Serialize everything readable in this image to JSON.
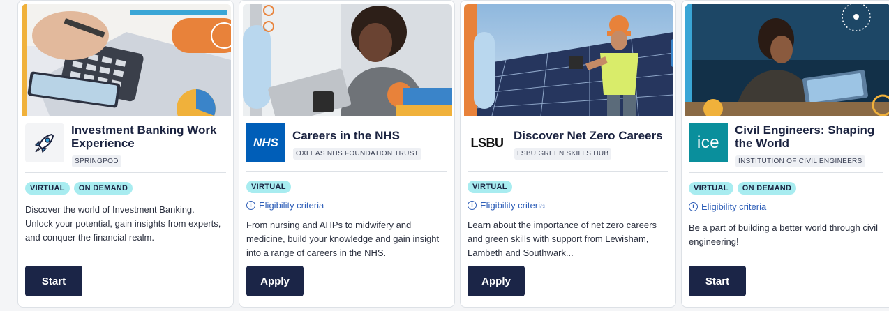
{
  "cards": [
    {
      "title": "Investment Banking Work Experience",
      "org": "SPRINGPOD",
      "tags": [
        "VIRTUAL",
        "ON DEMAND"
      ],
      "eligibility": "",
      "description": "Discover the world of Investment Banking. Unlock your potential, gain insights from experts, and conquer the financial realm.",
      "button": "Start",
      "logo_icon": "rocket-icon"
    },
    {
      "title": "Careers in the NHS",
      "org": "OXLEAS NHS FOUNDATION TRUST",
      "tags": [
        "VIRTUAL"
      ],
      "eligibility": "Eligibility criteria",
      "description": "From nursing and AHPs to midwifery and medicine, build your knowledge and gain insight into a range of careers in the NHS.",
      "button": "Apply",
      "logo_text": "NHS"
    },
    {
      "title": "Discover Net Zero Careers",
      "org": "LSBU GREEN SKILLS HUB",
      "tags": [
        "VIRTUAL"
      ],
      "eligibility": "Eligibility criteria",
      "description": "Learn about the importance of net zero careers and green skills with support from Lewisham, Lambeth and Southwark...",
      "button": "Apply",
      "logo_text": "LSBU"
    },
    {
      "title": "Civil Engineers: Shaping the World",
      "org": "INSTITUTION OF CIVIL ENGINEERS",
      "tags": [
        "VIRTUAL",
        "ON DEMAND"
      ],
      "eligibility": "Eligibility criteria",
      "description": "Be a part of building a better world through civil engineering!",
      "button": "Start",
      "logo_text": "ice"
    }
  ],
  "colors": {
    "button_bg": "#1b2547",
    "tag_bg": "#a8ecf0",
    "link": "#2f5fb8",
    "nhs_blue": "#005eb8",
    "ice_teal": "#0a8f9c"
  }
}
